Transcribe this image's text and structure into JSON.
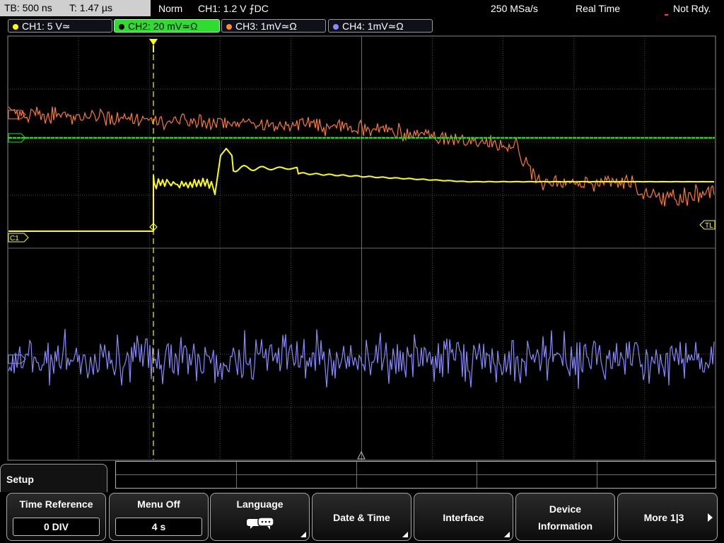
{
  "topbar": {
    "timebase": "TB: 500 ns",
    "trigger_time": "T: 1.47 µs",
    "mode": "Norm",
    "trigger_source": "CH1: 1.2 V",
    "trigger_slope": "⨍DC",
    "sample_rate": "250 MSa/s",
    "acquisition": "Real Time",
    "status": "Not Rdy."
  },
  "channels": [
    {
      "label": "CH1: 5 V≃",
      "color": "#ffff00",
      "active": false
    },
    {
      "label": "CH2: 20 mV≃Ω",
      "color": "#33ee33",
      "active": true
    },
    {
      "label": "CH3: 1mV≃Ω",
      "color": "#ff8a2a",
      "active": false
    },
    {
      "label": "CH4: 1mV≃Ω",
      "color": "#8a8aff",
      "active": false
    }
  ],
  "markers": {
    "ch1": "C1",
    "trigger_level": "TL"
  },
  "colors": {
    "ch1": "#ffff00",
    "ch2": "#22dd22",
    "ch3": "#ff7a22",
    "ch4": "#8888ff",
    "grid": "#6a6a6a"
  },
  "menu": {
    "title": "Setup",
    "keys": [
      {
        "label": "Time Reference",
        "value": "0 DIV"
      },
      {
        "label": "Menu Off",
        "value": "4 s"
      },
      {
        "label": "Language",
        "icon": "speech-bubble-icon"
      },
      {
        "label": "Date & Time"
      },
      {
        "label": "Interface"
      },
      {
        "label1": "Device",
        "label2": "Information"
      },
      {
        "label": "More 1|3"
      }
    ]
  }
}
